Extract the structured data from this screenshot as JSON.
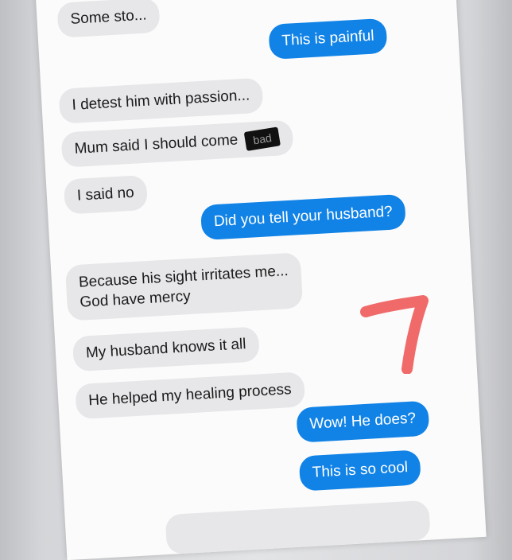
{
  "messages": [
    {
      "id": "m0",
      "side": "received",
      "text": "Some sto..."
    },
    {
      "id": "m1",
      "side": "sent",
      "text": "This is painful"
    },
    {
      "id": "m2",
      "side": "received",
      "text": "I detest him with passion..."
    },
    {
      "id": "m3",
      "side": "received",
      "text": "Mum said I should come",
      "redacted_fragment": "bad"
    },
    {
      "id": "m4",
      "side": "received",
      "text": "I said no"
    },
    {
      "id": "m5",
      "side": "sent",
      "text": "Did you tell your husband?"
    },
    {
      "id": "m6",
      "side": "received",
      "line1": "Because his sight irritates  me...",
      "line2": "God have mercy"
    },
    {
      "id": "m7",
      "side": "received",
      "text": "My husband knows it all"
    },
    {
      "id": "m8",
      "side": "received",
      "text": "He helped my healing process"
    },
    {
      "id": "m9",
      "side": "sent",
      "text": "Wow! He does?"
    },
    {
      "id": "m10",
      "side": "sent",
      "text": "This is so cool"
    }
  ],
  "colors": {
    "sent_bubble": "#1283e6",
    "received_bubble": "#e7e7ea",
    "annotation": "#f06a6a"
  },
  "annotation_shape": "hand-drawn-red-seven-mark"
}
